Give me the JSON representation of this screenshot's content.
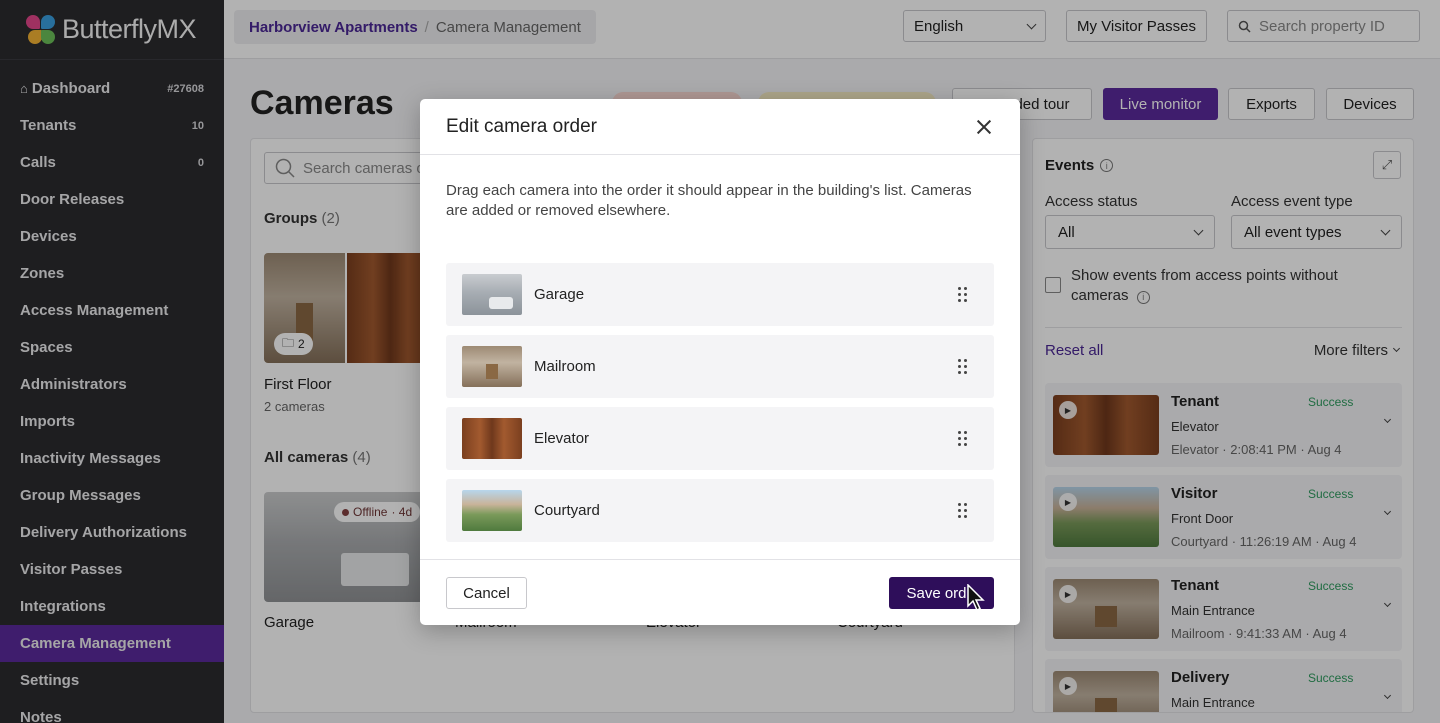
{
  "brand": {
    "name": "ButterflyMX"
  },
  "sidebar": {
    "items": [
      {
        "label": "Dashboard",
        "count": "#27608",
        "icon": "home-icon"
      },
      {
        "label": "Tenants",
        "count": "10"
      },
      {
        "label": "Calls",
        "count": "0"
      },
      {
        "label": "Door Releases",
        "count": ""
      },
      {
        "label": "Devices",
        "count": ""
      },
      {
        "label": "Zones",
        "count": ""
      },
      {
        "label": "Access Management",
        "count": ""
      },
      {
        "label": "Spaces",
        "count": ""
      },
      {
        "label": "Administrators",
        "count": ""
      },
      {
        "label": "Imports",
        "count": ""
      },
      {
        "label": "Inactivity Messages",
        "count": ""
      },
      {
        "label": "Group Messages",
        "count": ""
      },
      {
        "label": "Delivery Authorizations",
        "count": ""
      },
      {
        "label": "Visitor Passes",
        "count": ""
      },
      {
        "label": "Integrations",
        "count": ""
      },
      {
        "label": "Camera Management",
        "count": "",
        "active": true
      },
      {
        "label": "Settings",
        "count": ""
      },
      {
        "label": "Notes",
        "count": ""
      }
    ]
  },
  "topbar": {
    "breadcrumb": {
      "property": "Harborview Apartments",
      "separator": "/",
      "current": "Camera Management"
    },
    "language": "English",
    "visitor_passes_label": "My Visitor Passes",
    "search_placeholder": "Search property ID"
  },
  "page": {
    "title": "Cameras",
    "buttons": {
      "tour": "Guided tour",
      "tour_visible": "ded tour",
      "live": "Live monitor",
      "exports": "Exports",
      "devices": "Devices"
    },
    "search_placeholder": "Search cameras or",
    "groups_label": "Groups",
    "groups_count": "(2)",
    "group": {
      "name": "First Floor",
      "sub": "2 cameras",
      "folder_count": "2"
    },
    "all_cameras_label": "All cameras",
    "all_cameras_count": "(4)",
    "cameras": [
      "Garage",
      "Mailroom",
      "Elevator",
      "Courtyard"
    ],
    "offline_badge": {
      "label": "Offline",
      "age": "· 4d"
    }
  },
  "events": {
    "title": "Events",
    "access_status_label": "Access status",
    "access_status_value": "All",
    "access_event_type_label": "Access event type",
    "access_event_type_value": "All event types",
    "checkbox_label": "Show events from access points without cameras",
    "reset_label": "Reset all",
    "more_filters_label": "More filters",
    "items": [
      {
        "type": "Tenant",
        "status": "Success",
        "door": "Elevator",
        "meta": "Elevator · 2:08:41 PM · Aug 4",
        "scene": "elevator"
      },
      {
        "type": "Visitor",
        "status": "Success",
        "door": "Front Door",
        "meta": "Courtyard · 11:26:19 AM · Aug 4",
        "scene": "court"
      },
      {
        "type": "Tenant",
        "status": "Success",
        "door": "Main Entrance",
        "meta": "Mailroom · 9:41:33 AM · Aug 4",
        "scene": "mail"
      },
      {
        "type": "Delivery",
        "status": "Success",
        "door": "Main Entrance",
        "meta": "",
        "scene": "mail"
      }
    ]
  },
  "modal": {
    "title": "Edit camera order",
    "description": "Drag each camera into the order it should appear in the building's list. Cameras are added or removed elsewhere.",
    "items": [
      {
        "name": "Garage",
        "scene": "garage"
      },
      {
        "name": "Mailroom",
        "scene": "mail"
      },
      {
        "name": "Elevator",
        "scene": "elevator"
      },
      {
        "name": "Courtyard",
        "scene": "court"
      }
    ],
    "cancel_label": "Cancel",
    "save_label": "Save order",
    "save_visible": "Save ord"
  },
  "colors": {
    "accent": "#5b2a9c",
    "link": "#4b2896",
    "save": "#2e0e5a",
    "success": "#2e9b5f",
    "offline": "#d52b2b",
    "sidebar": "#2b2b2f"
  }
}
